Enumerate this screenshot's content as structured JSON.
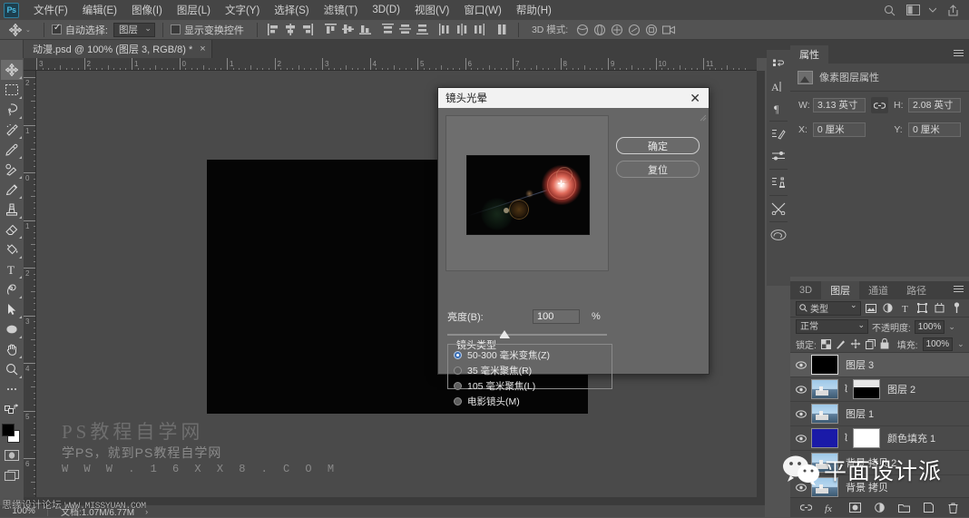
{
  "app": {
    "logo": "Ps",
    "menus": [
      "文件(F)",
      "编辑(E)",
      "图像(I)",
      "图层(L)",
      "文字(Y)",
      "选择(S)",
      "滤镜(T)",
      "3D(D)",
      "视图(V)",
      "窗口(W)",
      "帮助(H)"
    ],
    "top_right_icons": [
      "search-icon",
      "workspace-icon",
      "chevron-down-icon",
      "share-icon"
    ]
  },
  "options_bar": {
    "tool_icon": "move-tool-icon",
    "auto_select_label": "自动选择:",
    "auto_select_checked": true,
    "auto_select_value": "图层",
    "show_transform_label": "显示变换控件",
    "show_transform_checked": false,
    "mode_3d_label": "3D 模式:",
    "align_icons": [
      "align-left-edges",
      "align-horizontal-centers",
      "align-right-edges",
      "align-top-edges",
      "align-vertical-centers",
      "align-bottom-edges",
      "distribute-top",
      "distribute-vertical-center",
      "distribute-bottom",
      "distribute-left",
      "distribute-horizontal-center",
      "distribute-right",
      "align-options"
    ],
    "mode3d_icons": [
      "rotate-3d-icon",
      "roll-3d-icon",
      "drag-3d-icon",
      "slide-3d-icon",
      "scale-3d-icon",
      "camera-3d-icon"
    ]
  },
  "document": {
    "tab_title": "动漫.psd @ 100% (图层 3, RGB/8) *",
    "close_glyph": "×"
  },
  "toolbar": {
    "tools": [
      {
        "name": "move-tool",
        "active": true
      },
      {
        "name": "rectangular-marquee-tool",
        "active": false
      },
      {
        "name": "lasso-tool",
        "active": false
      },
      {
        "name": "quick-selection-tool",
        "active": false
      },
      {
        "name": "crop-tool",
        "active": false
      },
      {
        "name": "eyedropper-tool",
        "active": false
      },
      {
        "name": "healing-brush-tool",
        "active": false
      },
      {
        "name": "brush-tool",
        "active": false
      },
      {
        "name": "clone-stamp-tool",
        "active": false
      },
      {
        "name": "eraser-tool",
        "active": false
      },
      {
        "name": "gradient-tool",
        "active": false
      },
      {
        "name": "paint-bucket-tool",
        "active": false
      },
      {
        "name": "type-tool",
        "active": false
      },
      {
        "name": "pen-tool",
        "active": false
      },
      {
        "name": "path-selection-tool",
        "active": false
      },
      {
        "name": "ellipse-tool",
        "active": false
      },
      {
        "name": "hand-tool",
        "active": false
      },
      {
        "name": "zoom-tool",
        "active": false
      },
      {
        "name": "edit-toolbar-tool",
        "active": false
      }
    ],
    "foreground_color": "#000000",
    "background_color": "#ffffff",
    "quick-mask": "quick-mask-icon",
    "screen-mode": "screen-mode-icon"
  },
  "rulers": {
    "horizontal": [
      "3",
      "2",
      "1",
      "0",
      "1",
      "2",
      "3",
      "4",
      "5",
      "6",
      "7",
      "8",
      "9",
      "10",
      "11"
    ],
    "vertical": [
      "2",
      "1",
      "0",
      "1",
      "2",
      "3",
      "4",
      "5",
      "6"
    ]
  },
  "canvas": {
    "watermark_main": "PS教程自学网",
    "watermark_sub": "学PS，就到PS教程自学网",
    "watermark_url": "W W W . 1 6 X X 8 . C O M"
  },
  "status_bar": {
    "zoom": "100%",
    "doc_info": "文档:1.07M/6.77M",
    "arrow": "›",
    "forum_watermark": "思缘设计论坛",
    "forum_url": "WWW.MISSYUAN.COM"
  },
  "icon_dock": [
    "history-icon",
    "character-icon",
    "paragraph-icon",
    "brush-settings-icon",
    "adjustments-icon",
    "clone-source-icon",
    "tools-icon",
    "creative-cloud-icon"
  ],
  "properties_panel": {
    "tabs": [
      {
        "label": "属性",
        "active": true
      }
    ],
    "header": "像素图层属性",
    "header_icon": "pixel-layer-icon",
    "fields": [
      {
        "key": "W:",
        "value": "3.13 英寸"
      },
      {
        "key": "H:",
        "value": "2.08 英寸"
      },
      {
        "key": "X:",
        "value": "0 厘米"
      },
      {
        "key": "Y:",
        "value": "0 厘米"
      }
    ],
    "link_icon": "link-icon",
    "menu_icon": "panel-menu-icon"
  },
  "layers_panel": {
    "tabs": [
      {
        "label": "3D",
        "active": false
      },
      {
        "label": "图层",
        "active": true
      },
      {
        "label": "通道",
        "active": false
      },
      {
        "label": "路径",
        "active": false
      }
    ],
    "filter_label": "类型",
    "filter_icons": [
      "filter-pixel-icon",
      "filter-adjustment-icon",
      "filter-type-icon",
      "filter-shape-icon",
      "filter-smart-icon",
      "filter-toggle-icon"
    ],
    "blend_mode": "正常",
    "opacity_label": "不透明度:",
    "opacity_value": "100%",
    "lock_label": "锁定:",
    "lock_icons": [
      "lock-transparent-icon",
      "lock-image-icon",
      "lock-position-icon",
      "lock-artboard-icon",
      "lock-all-icon"
    ],
    "fill_label": "填充:",
    "fill_value": "100%",
    "layers": [
      {
        "name": "图层 3",
        "visible": true,
        "selected": true,
        "thumb": "black",
        "has_mask": false
      },
      {
        "name": "图层 2",
        "visible": true,
        "selected": false,
        "thumb": "photo",
        "has_mask": true
      },
      {
        "name": "图层 1",
        "visible": true,
        "selected": false,
        "thumb": "photo",
        "has_mask": false
      },
      {
        "name": "颜色填充 1",
        "visible": true,
        "selected": false,
        "thumb": "blue",
        "has_mask": true
      },
      {
        "name": "背景 拷贝 2",
        "visible": true,
        "selected": false,
        "thumb": "photo",
        "has_mask": false
      },
      {
        "name": "背景 拷贝",
        "visible": true,
        "selected": false,
        "thumb": "photo",
        "has_mask": false
      }
    ],
    "bottom_icons": [
      "link-layers-icon",
      "layer-style-icon",
      "layer-mask-icon",
      "adjustment-layer-icon",
      "new-group-icon",
      "new-layer-icon",
      "delete-layer-icon"
    ]
  },
  "wechat_watermark": {
    "text": "平面设计派",
    "logo": "wechat-icon"
  },
  "dialog": {
    "title": "镜头光晕",
    "close_glyph": "✕",
    "buttons": [
      {
        "label": "确定",
        "primary": true
      },
      {
        "label": "复位",
        "primary": false
      }
    ],
    "brightness_label": "亮度(B):",
    "brightness_value": "100",
    "brightness_unit": "%",
    "lens_group_label": "镜头类型",
    "lens_options": [
      {
        "label": "50-300 毫米变焦(Z)",
        "selected": true
      },
      {
        "label": "35 毫米聚焦(R)",
        "selected": false
      },
      {
        "label": "105 毫米聚焦(L)",
        "selected": false
      },
      {
        "label": "电影镜头(M)",
        "selected": false
      }
    ]
  },
  "colors": {
    "chrome": "#535353",
    "panel": "#4a4a4a",
    "menu": "#454545",
    "dialog": "#666666",
    "dialog_title": "#f2f2f2",
    "accent": "#3a6fb5"
  }
}
